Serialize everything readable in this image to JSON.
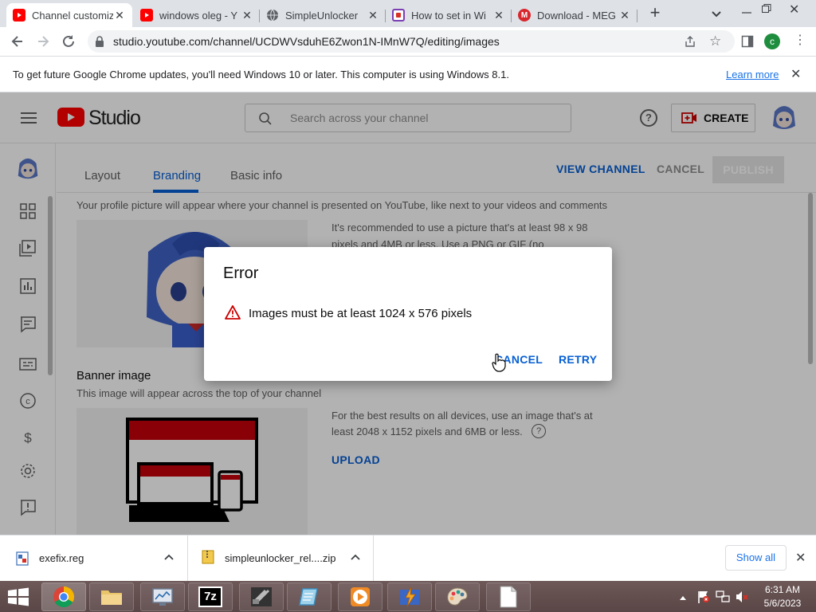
{
  "browser": {
    "tabs": [
      {
        "title": "Channel customiz",
        "favicon": "youtube-icon",
        "active": true
      },
      {
        "title": "windows oleg - Y",
        "favicon": "youtube-icon",
        "active": false
      },
      {
        "title": "SimpleUnlocker",
        "favicon": "globe-icon",
        "active": false
      },
      {
        "title": "How to set in Wi",
        "favicon": "app-icon",
        "active": false
      },
      {
        "title": "Download - MEG",
        "favicon": "mega-icon",
        "active": false
      }
    ],
    "new_tab_symbol": "+",
    "url": "studio.youtube.com/channel/UCDWVsduhE6Zwon1N-IMnW7Q/editing/images",
    "profile_initial": "c",
    "accent_color": "#1e8e3e"
  },
  "infobar": {
    "message": "To get future Google Chrome updates, you'll need Windows 10 or later. This computer is using Windows 8.1.",
    "link": "Learn more"
  },
  "studio": {
    "logo_text": "Studio",
    "search_placeholder": "Search across your channel",
    "create_label": "CREATE",
    "tabs": [
      "Layout",
      "Branding",
      "Basic info"
    ],
    "active_tab": "Branding",
    "view_channel": "VIEW CHANNEL",
    "cancel": "CANCEL",
    "publish": "PUBLISH",
    "profile_desc": "Your profile picture will appear where your channel is presented on YouTube, like next to your videos and comments",
    "profile_hint_line1": "It's recommended to use a picture that's at least 98 x 98",
    "profile_hint_line2": "pixels and 4MB or less. Use a PNG or GIF (no",
    "banner_title": "Banner image",
    "banner_desc": "This image will appear across the top of your channel",
    "banner_hint_line1": "For the best results on all devices, use an image that's at",
    "banner_hint_line2": "least 2048 x 1152 pixels and 6MB or less.",
    "upload": "UPLOAD",
    "brand_red": "#ff0000",
    "link_blue": "#065fd4"
  },
  "dialog": {
    "title": "Error",
    "message": "Images must be at least 1024 x 576 pixels",
    "cancel": "CANCEL",
    "retry": "RETRY"
  },
  "downloads": {
    "items": [
      {
        "name": "exefix.reg",
        "icon": "reg-file-icon"
      },
      {
        "name": "simpleunlocker_rel....zip",
        "icon": "zip-file-icon"
      }
    ],
    "show_all": "Show all"
  },
  "taskbar": {
    "time": "6:31 AM",
    "date": "5/6/2023"
  }
}
